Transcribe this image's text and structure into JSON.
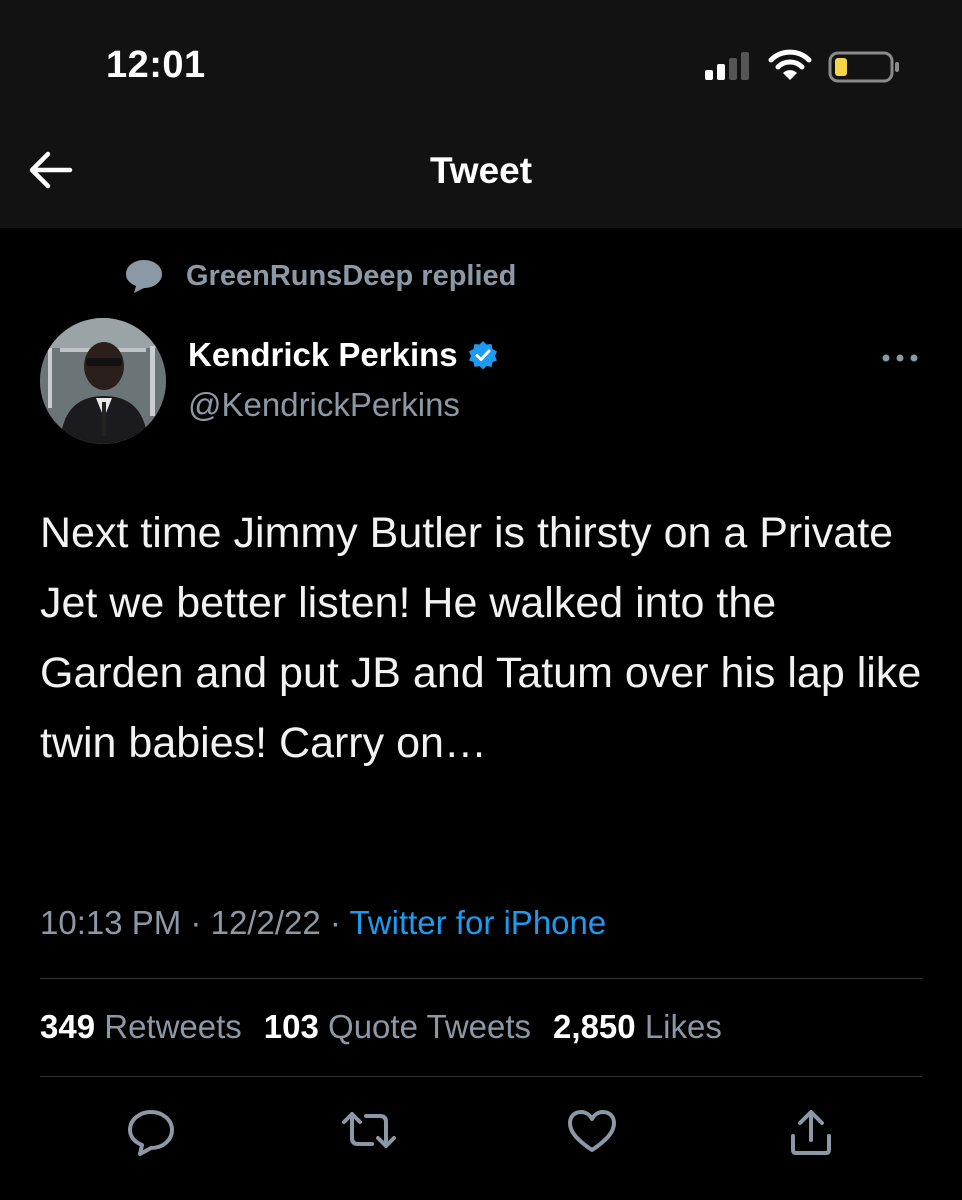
{
  "status_bar": {
    "time": "12:01"
  },
  "header": {
    "title": "Tweet"
  },
  "social_context": {
    "text": "GreenRunsDeep replied"
  },
  "author": {
    "name": "Kendrick Perkins",
    "handle": "@KendrickPerkins",
    "verified": true
  },
  "tweet": {
    "text": "Next time Jimmy Butler is thirsty on a Private Jet we better listen! He walked into the Garden and put JB and Tatum over his lap like twin babies! Carry on…",
    "time": "10:13 PM",
    "date": "12/2/22",
    "separator": "·",
    "source": "Twitter for iPhone"
  },
  "stats": {
    "retweets_count": "349",
    "retweets_label": "Retweets",
    "quotes_count": "103",
    "quotes_label": "Quote Tweets",
    "likes_count": "2,850",
    "likes_label": "Likes"
  },
  "actions": [
    "reply-icon",
    "retweet-icon",
    "like-icon",
    "share-icon"
  ],
  "colors": {
    "background": "#000000",
    "header_bg": "#121212",
    "accent": "#1d9bf0",
    "muted": "#8b98a5",
    "battery_low": "#f7d54a"
  }
}
